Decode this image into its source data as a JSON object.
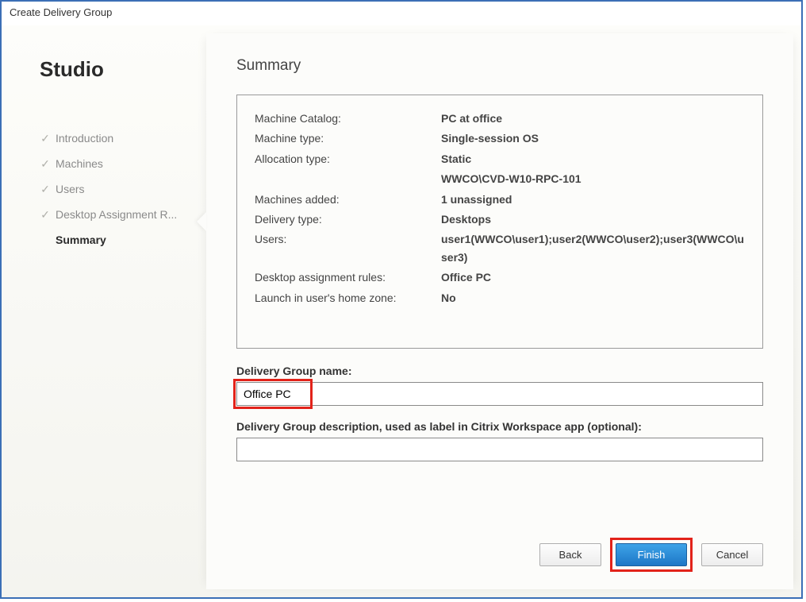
{
  "window": {
    "title": "Create Delivery Group"
  },
  "sidebar": {
    "brand": "Studio",
    "steps": [
      {
        "label": "Introduction",
        "done": true
      },
      {
        "label": "Machines",
        "done": true
      },
      {
        "label": "Users",
        "done": true
      },
      {
        "label": "Desktop Assignment R...",
        "done": true
      },
      {
        "label": "Summary",
        "done": false,
        "active": true
      }
    ]
  },
  "page": {
    "heading": "Summary",
    "rows": [
      {
        "label": "Machine Catalog:",
        "value": "PC at office"
      },
      {
        "label": "Machine type:",
        "value": "Single-session OS"
      },
      {
        "label": "Allocation type:",
        "value": "Static"
      },
      {
        "label": "",
        "value": "WWCO\\CVD-W10-RPC-101"
      },
      {
        "label": "Machines added:",
        "value": "1 unassigned"
      },
      {
        "label": "Delivery type:",
        "value": "Desktops"
      },
      {
        "label": "Users:",
        "value": "user1(WWCO\\user1);user2(WWCO\\user2);user3(WWCO\\user3)"
      },
      {
        "label": "Desktop assignment rules:",
        "value": "Office PC"
      },
      {
        "label": "Launch in user's home zone:",
        "value": "No"
      }
    ],
    "name_label": "Delivery Group name:",
    "name_value": "Office PC",
    "desc_label": "Delivery Group description, used as label in Citrix Workspace app (optional):",
    "desc_value": ""
  },
  "buttons": {
    "back": "Back",
    "finish": "Finish",
    "cancel": "Cancel"
  }
}
